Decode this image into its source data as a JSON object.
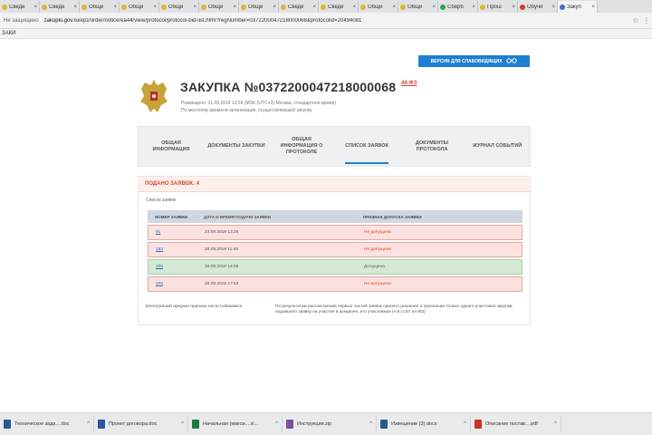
{
  "browser": {
    "tabs": [
      {
        "label": "Сведе",
        "icon": "yellow"
      },
      {
        "label": "Сведе",
        "icon": "yellow"
      },
      {
        "label": "Общи",
        "icon": "yellow"
      },
      {
        "label": "Общи",
        "icon": "yellow"
      },
      {
        "label": "Общи",
        "icon": "yellow"
      },
      {
        "label": "Общи",
        "icon": "yellow"
      },
      {
        "label": "Общи",
        "icon": "yellow"
      },
      {
        "label": "Сведе",
        "icon": "yellow"
      },
      {
        "label": "Сведе",
        "icon": "yellow"
      },
      {
        "label": "Общи",
        "icon": "yellow"
      },
      {
        "label": "Общи",
        "icon": "yellow"
      },
      {
        "label": "Сберб",
        "icon": "green"
      },
      {
        "label": "Прош",
        "icon": "yellow"
      },
      {
        "label": "Обучи",
        "icon": "red"
      },
      {
        "label": "Закуп",
        "icon": "blue"
      }
    ],
    "tab_close": "×",
    "not_secure": "Не защищено",
    "url_host": "zakupki.gov.ru",
    "url_path": "/epz/order/notice/ea44/view/protocol/protocol-bid-list.html?regNumber=0372200047218000068&protocolId=20494081",
    "star_icon": "☆",
    "menu_icon": "⋮",
    "bookmarks_label": "ЗАКИ"
  },
  "page": {
    "vision_button": "ВЕРСИЯ ДЛЯ СЛАБОВИДЯЩИХ",
    "vision_icon": "👓",
    "title": "ЗАКУПКА №0372200047218000068",
    "law_badge": "44-ФЗ",
    "published": "Размещено: 21.09.2018 12:56 (MSK (UTC+3) Москва, стандартное время)",
    "timezone_note": "По местному времени организации, осуществляющей закупку",
    "tabs": [
      {
        "label": "ОБЩАЯ ИНФОРМАЦИЯ",
        "active": false
      },
      {
        "label": "ДОКУМЕНТЫ ЗАКУПКИ",
        "active": false
      },
      {
        "label": "ОБЩАЯ ИНФОРМАЦИЯ О ПРОТОКОЛЕ",
        "active": false
      },
      {
        "label": "СПИСОК ЗАЯВОК",
        "active": true
      },
      {
        "label": "ДОКУМЕНТЫ ПРОТОКОЛА",
        "active": false
      },
      {
        "label": "ЖУРНАЛ СОБЫТИЙ",
        "active": false
      }
    ],
    "bids_header": "ПОДАНО ЗАЯВОК: 4",
    "list_title": "Список заявок",
    "columns": [
      "НОМЕР ЗАЯВКИ",
      "ДАТА И ВРЕМЯ ПОДАЧИ ЗАЯВКИ",
      "ПРИЗНАК ДОПУСКА ЗАЯВКИ"
    ],
    "rows": [
      {
        "number": "91",
        "datetime": "23.09.2018 13:28",
        "status": "Не допущена",
        "admitted": false
      },
      {
        "number": "183",
        "datetime": "28.09.2018 11:48",
        "status": "Не допущена",
        "admitted": false
      },
      {
        "number": "208",
        "datetime": "28.09.2018 14:56",
        "status": "Допущена",
        "admitted": true
      },
      {
        "number": "206",
        "datetime": "29.09.2018 17:43",
        "status": "Не допущена",
        "admitted": false
      }
    ],
    "footnote_left": "Электронный аукцион признан несостоявшимся",
    "footnote_right": "По результатам рассмотрения первых частей заявок принято решение о признании только одного участника закупки, подавшего заявку на участие в аукционе, его участником (ч.8 ст.67 44-ФЗ)"
  },
  "taskbar": {
    "items": [
      {
        "label": "Техническое зада....doc",
        "type": "word"
      },
      {
        "label": "Проект договора.doc",
        "type": "word"
      },
      {
        "label": "Начальная (макси....xl...",
        "type": "excel"
      },
      {
        "label": "Инструкция.zip",
        "type": "zip"
      },
      {
        "label": "Извещение (3).docx",
        "type": "word"
      },
      {
        "label": "Описание постав....pdf",
        "type": "pdf"
      }
    ],
    "arrow": "^"
  }
}
